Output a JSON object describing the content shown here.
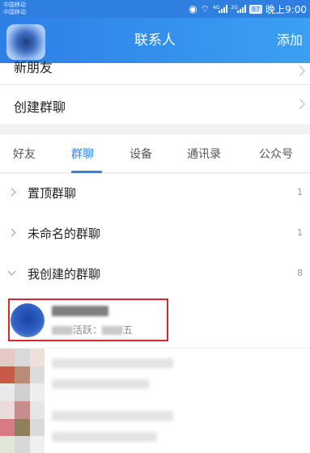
{
  "status_bar": {
    "carrier_1": "中国移动",
    "carrier_2": "中国移动",
    "battery": "87",
    "time": "晚上9:00"
  },
  "nav": {
    "title": "联系人",
    "add": "添加"
  },
  "top_items": [
    {
      "label": "新朋友"
    },
    {
      "label": "创建群聊"
    }
  ],
  "tabs": [
    {
      "label": "好友",
      "active": false
    },
    {
      "label": "群聊",
      "active": true
    },
    {
      "label": "设备",
      "active": false
    },
    {
      "label": "通讯录",
      "active": false
    },
    {
      "label": "公众号",
      "active": false
    }
  ],
  "groups": [
    {
      "label": "置顶群聊",
      "count": "1",
      "expanded": false
    },
    {
      "label": "未命名的群聊",
      "count": "1",
      "expanded": false
    },
    {
      "label": "我创建的群聊",
      "count": "8",
      "expanded": true
    }
  ],
  "highlighted_chat": {
    "active_label": "活跃：",
    "day": "五"
  },
  "colors": {
    "accent": "#2f86e8",
    "nav_blue": "#2d7fe6",
    "highlight_red": "#d9272e"
  }
}
